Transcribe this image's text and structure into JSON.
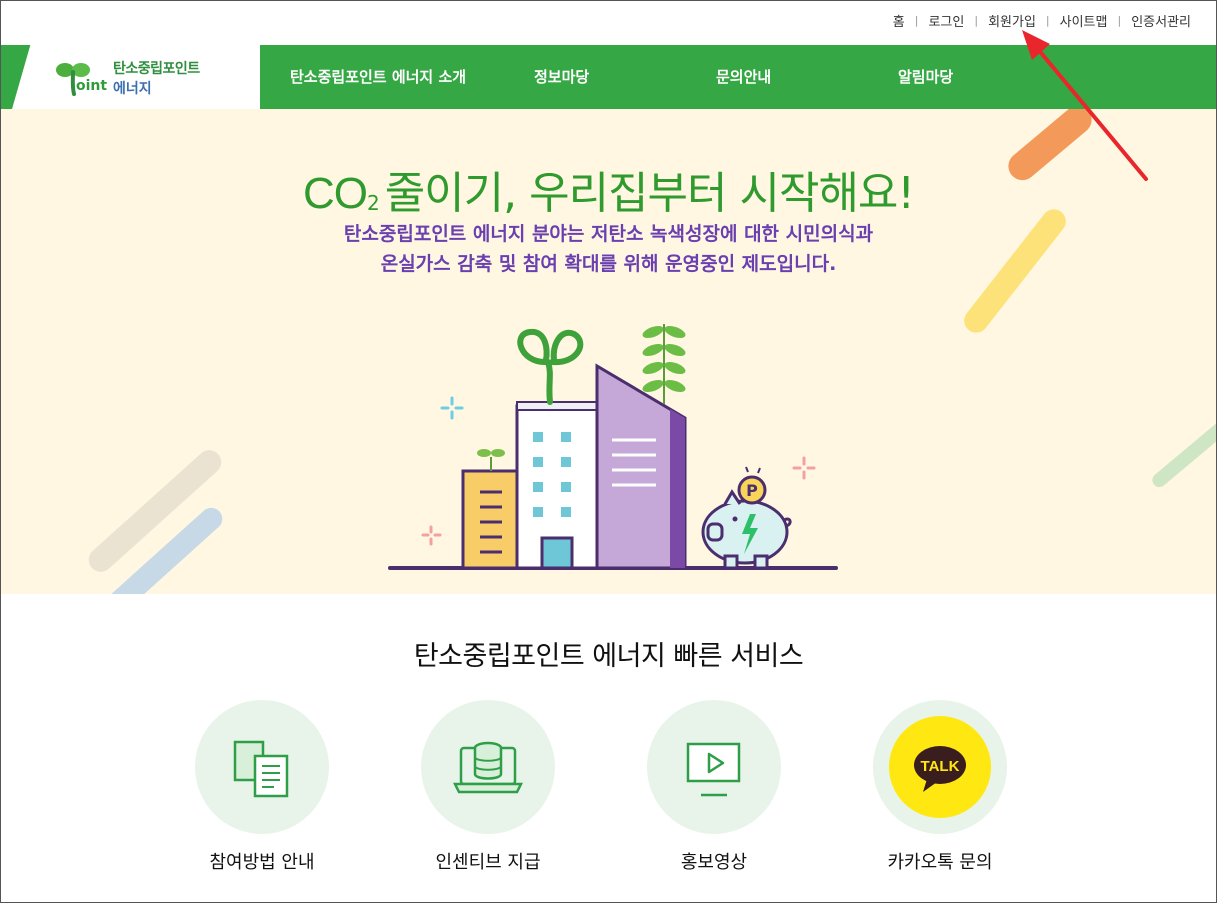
{
  "util_links": [
    "홈",
    "로그인",
    "회원가입",
    "사이트맵",
    "인증서관리"
  ],
  "logo": {
    "mark_letter": "oint",
    "line1": "탄소중립포인트",
    "line2": "에너지"
  },
  "nav": {
    "items": [
      "탄소중립포인트 에너지 소개",
      "정보마당",
      "문의안내",
      "알림마당"
    ]
  },
  "hero": {
    "title_co": "CO",
    "title_sub": "2",
    "title_rest": "줄이기, 우리집부터 시작해요!",
    "line1": "탄소중립포인트 에너지 분야는 저탄소 녹색성장에 대한 시민의식과",
    "line2": "온실가스 감축 및 참여 확대를 위해 운영중인 제도입니다.",
    "coin_letter": "P"
  },
  "quick": {
    "title": "탄소중립포인트 에너지 빠른 서비스",
    "items": [
      {
        "label": "참여방법 안내",
        "icon": "documents-icon"
      },
      {
        "label": "인센티브 지급",
        "icon": "coin-stack-laptop-icon"
      },
      {
        "label": "홍보영상",
        "icon": "play-video-icon"
      },
      {
        "label": "카카오톡 문의",
        "icon": "kakaotalk-icon",
        "badge": "TALK"
      }
    ]
  },
  "colors": {
    "nav_green": "#35a744",
    "hero_bg": "#fff7e1",
    "title_green": "#2f9a2e",
    "purple_text": "#6a3fb0",
    "kakao_yellow": "#ffe812",
    "arrow_red": "#e8262b"
  }
}
